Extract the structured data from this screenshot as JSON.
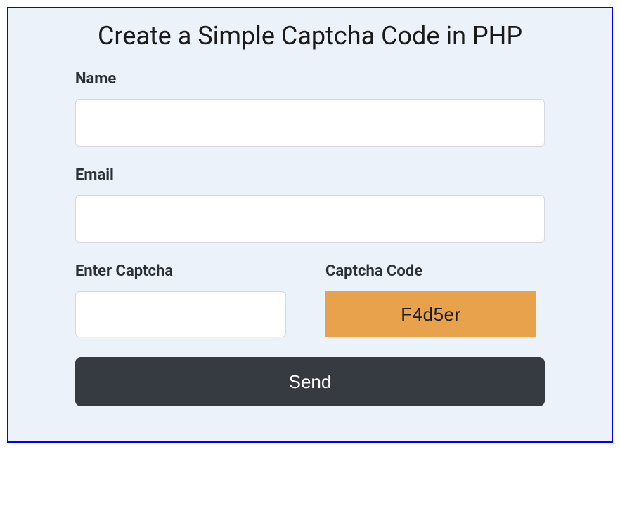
{
  "title": "Create a Simple Captcha Code in PHP",
  "form": {
    "name": {
      "label": "Name",
      "value": ""
    },
    "email": {
      "label": "Email",
      "value": ""
    },
    "enterCaptcha": {
      "label": "Enter Captcha",
      "value": ""
    },
    "captchaCode": {
      "label": "Captcha Code",
      "value": "F4d5er"
    },
    "submitLabel": "Send"
  }
}
